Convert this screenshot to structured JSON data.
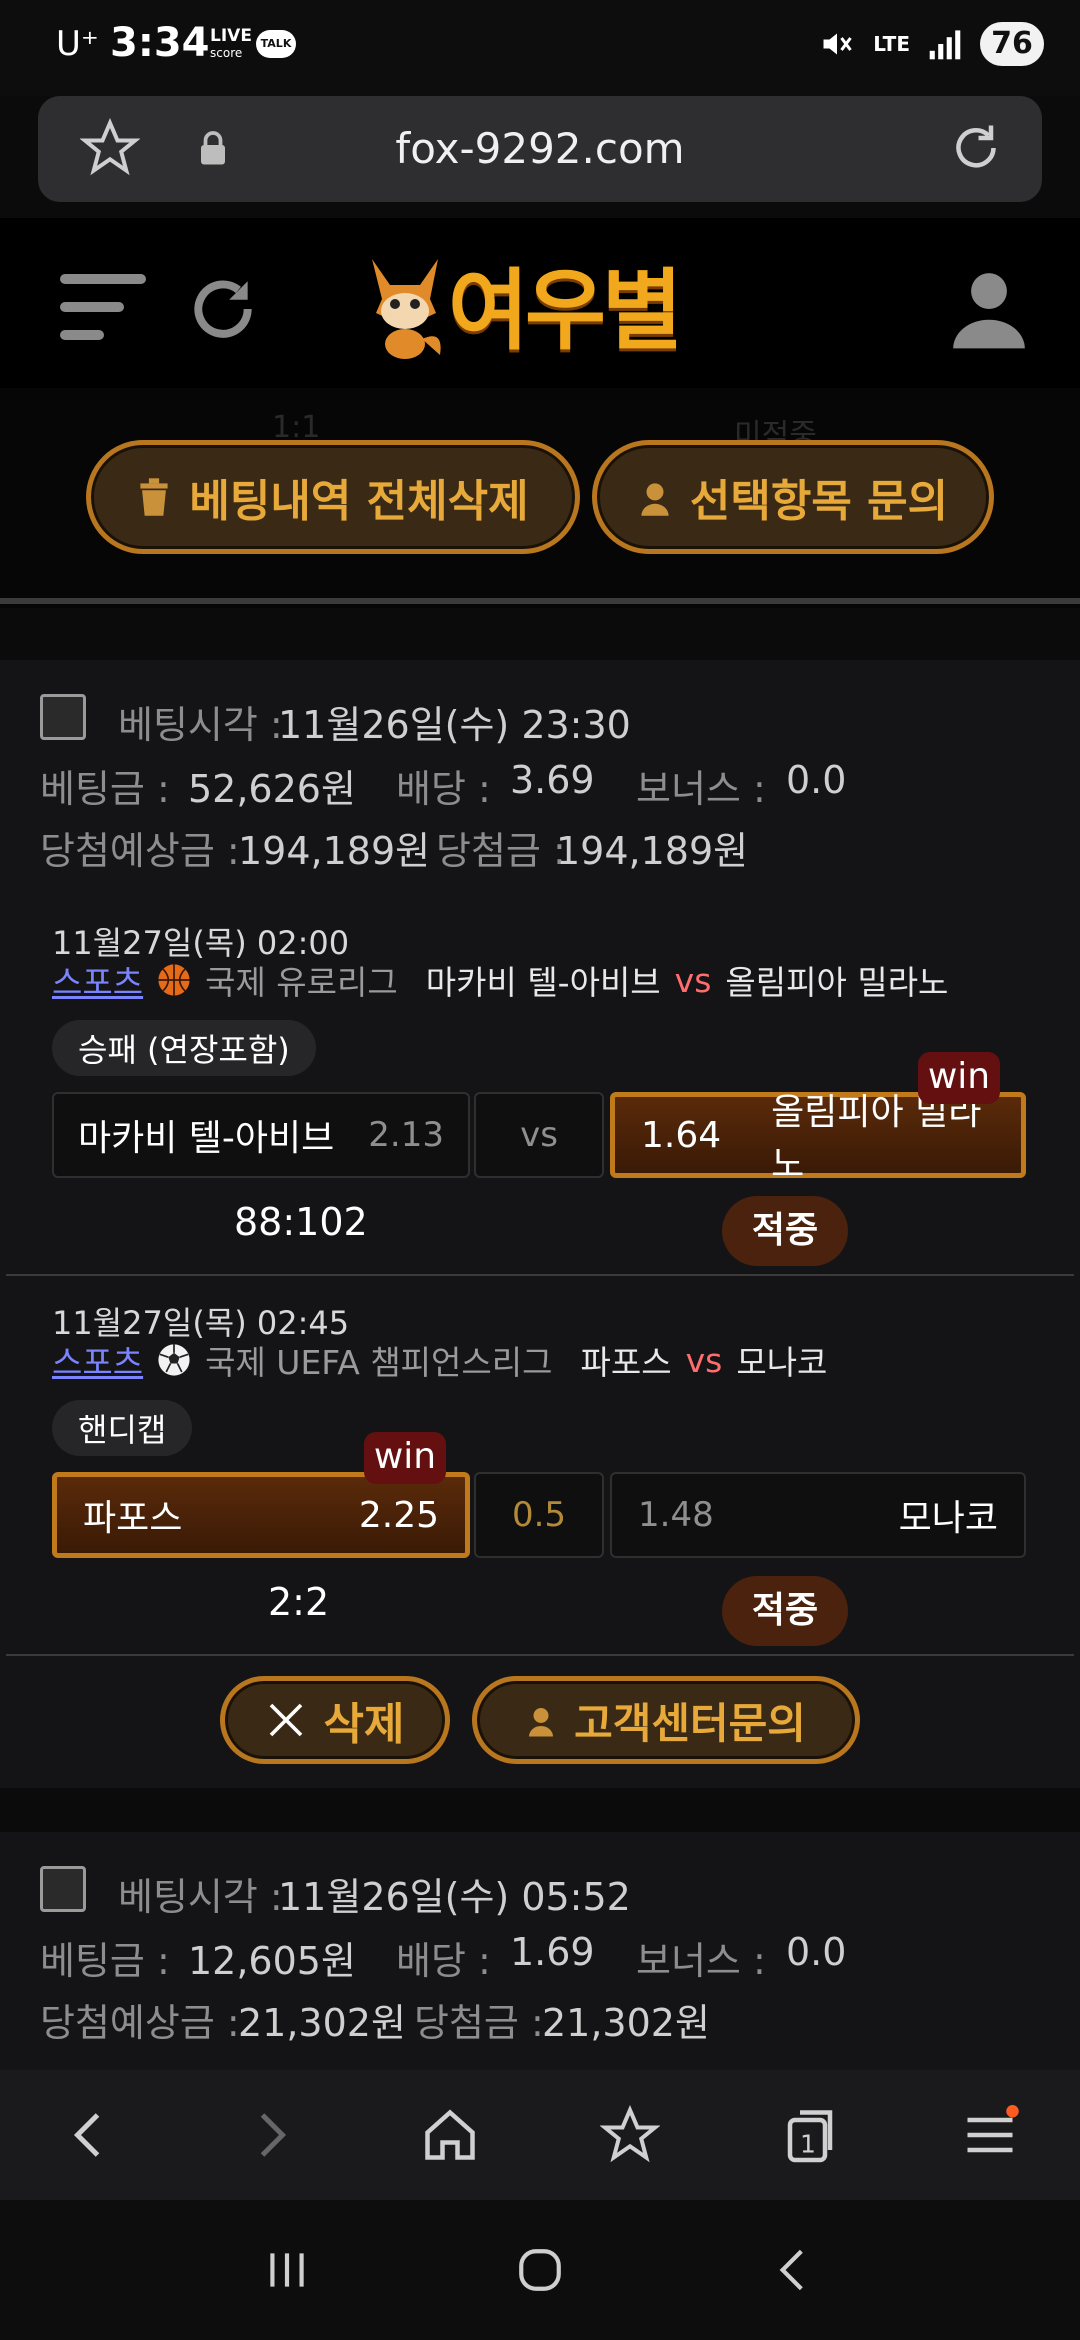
{
  "status_bar": {
    "carrier": "U⁺",
    "time": "3:34",
    "live_badge_top": "LIVE",
    "live_badge_bottom": "score",
    "talk": "TALK",
    "network": "LTE",
    "battery": "76"
  },
  "browser": {
    "url": "fox-9292.com"
  },
  "site": {
    "logo_text": "여우별",
    "ghost_left": "1:1",
    "ghost_right": "미적중"
  },
  "actions": {
    "delete_all": "베팅내역 전체삭제",
    "inquire_selected": "선택항목 문의"
  },
  "bets": [
    {
      "bet_time_label": "베팅시각 :",
      "bet_time": "11월26일(수) 23:30",
      "stake_label": "베팅금 :",
      "stake": "52,626원",
      "odds_label": "배당 :",
      "odds": "3.69",
      "bonus_label": "보너스 :",
      "bonus": "0.0",
      "expected_label": "당첨예상금 :",
      "expected": "194,189원",
      "won_label": "당첨금 :",
      "won": "194,189원",
      "games": [
        {
          "datetime": "11월27일(목) 02:00",
          "category": "스포츠",
          "sport_icon": "basketball-icon",
          "league": "국제 유로리그",
          "home": "마카비 텔-아비브",
          "vs": "vs",
          "away": "올림피아 밀라노",
          "market": "승패 (연장포함)",
          "home_name": "마카비 텔-아비브",
          "home_odds": "2.13",
          "mid": "vs",
          "away_odds": "1.64",
          "away_name": "올림피아 밀라노",
          "win_badge": "win",
          "score": "88:102",
          "result": "적중"
        },
        {
          "datetime": "11월27일(목) 02:45",
          "category": "스포츠",
          "sport_icon": "soccer-ball-icon",
          "league": "국제 UEFA 챔피언스리그",
          "home": "파포스",
          "vs": "vs",
          "away": "모나코",
          "market": "핸디캡",
          "home_name": "파포스",
          "home_odds": "2.25",
          "mid": "0.5",
          "away_odds": "1.48",
          "away_name": "모나코",
          "win_badge": "win",
          "score": "2:2",
          "result": "적중"
        }
      ],
      "delete_label": "삭제",
      "support_label": "고객센터문의"
    },
    {
      "bet_time_label": "베팅시각 :",
      "bet_time": "11월26일(수) 05:52",
      "stake_label": "베팅금 :",
      "stake": "12,605원",
      "odds_label": "배당 :",
      "odds": "1.69",
      "bonus_label": "보너스 :",
      "bonus": "0.0",
      "expected_label": "당첨예상금 :",
      "expected": "21,302원",
      "won_label": "당첨금 :",
      "won": "21,302원"
    }
  ],
  "colors": {
    "gold": "#e7a93a",
    "gold_border": "#b8761e",
    "win_bg": "#641010",
    "hit_bg": "#4a220e",
    "link": "#7a84ff",
    "vs": "#ff6d6d"
  }
}
